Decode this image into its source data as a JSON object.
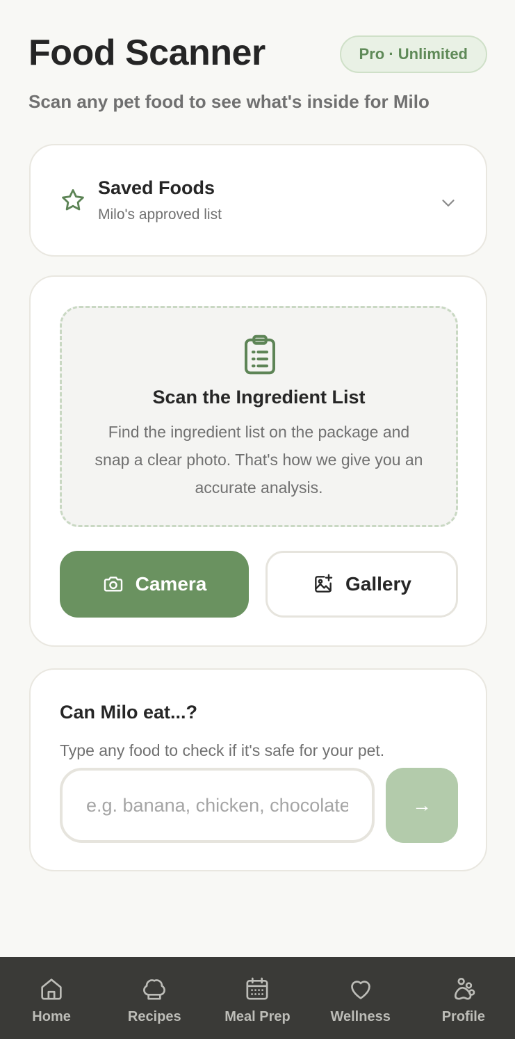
{
  "header": {
    "title": "Food Scanner",
    "badge": "Pro · Unlimited",
    "subtitle": "Scan any pet food to see what's inside for Milo"
  },
  "saved_foods": {
    "icon": "star-icon",
    "title": "Saved Foods",
    "subtitle": "Milo's approved list",
    "expand_icon": "chevron-down-icon"
  },
  "scan": {
    "icon": "clipboard-list-icon",
    "title": "Scan the Ingredient List",
    "description": "Find the ingredient list on the package and snap a clear photo. That's how we give you an accurate analysis.",
    "camera_label": "Camera",
    "gallery_label": "Gallery"
  },
  "ask": {
    "title": "Can Milo eat...?",
    "subtitle": "Type any food to check if it's safe for your pet.",
    "input_value": "",
    "input_placeholder": "e.g. banana, chicken, chocolate",
    "submit_symbol": "→"
  },
  "nav": {
    "items": [
      {
        "label": "Home",
        "icon": "home-icon"
      },
      {
        "label": "Recipes",
        "icon": "chef-hat-icon"
      },
      {
        "label": "Meal Prep",
        "icon": "calendar-icon"
      },
      {
        "label": "Wellness",
        "icon": "heart-icon"
      },
      {
        "label": "Profile",
        "icon": "paw-icon"
      }
    ]
  },
  "colors": {
    "accent": "#6a9260",
    "accent_light": "#b3cbab",
    "badge_bg": "#e9f1e5",
    "page_bg": "#f8f8f5",
    "nav_bg": "#3a3a37"
  }
}
